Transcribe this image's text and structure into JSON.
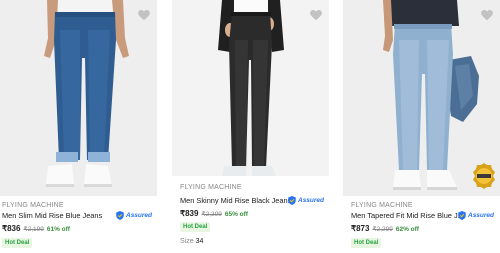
{
  "products": [
    {
      "brand": "FLYING MACHINE",
      "title": "Men Slim Mid Rise Blue Jeans",
      "assured_label": "Assured",
      "price": "₹836",
      "mrp": "₹2,199",
      "discount": "61% off",
      "deal": "Hot Deal",
      "image_icon": "jeans-photo-blue-slim"
    },
    {
      "brand": "FLYING MACHINE",
      "title": "Men Skinny Mid Rise Black Jeans",
      "assured_label": "Assured",
      "price": "₹839",
      "mrp": "₹2,399",
      "discount": "65% off",
      "deal": "Hot Deal",
      "size_label": "Size",
      "size_value": "34",
      "image_icon": "jeans-photo-black-skinny"
    },
    {
      "brand": "FLYING MACHINE",
      "title": "Men Tapered Fit Mid Rise Blue J...",
      "assured_label": "Assured",
      "price": "₹873",
      "mrp": "₹2,299",
      "discount": "62% off",
      "deal": "Hot Deal",
      "image_icon": "jeans-photo-light-blue-tapered"
    }
  ],
  "colors": {
    "accent": "#2874f0",
    "discount": "#388e3c",
    "deal_bg": "#e8f5e0",
    "deal_text": "#26a541"
  }
}
